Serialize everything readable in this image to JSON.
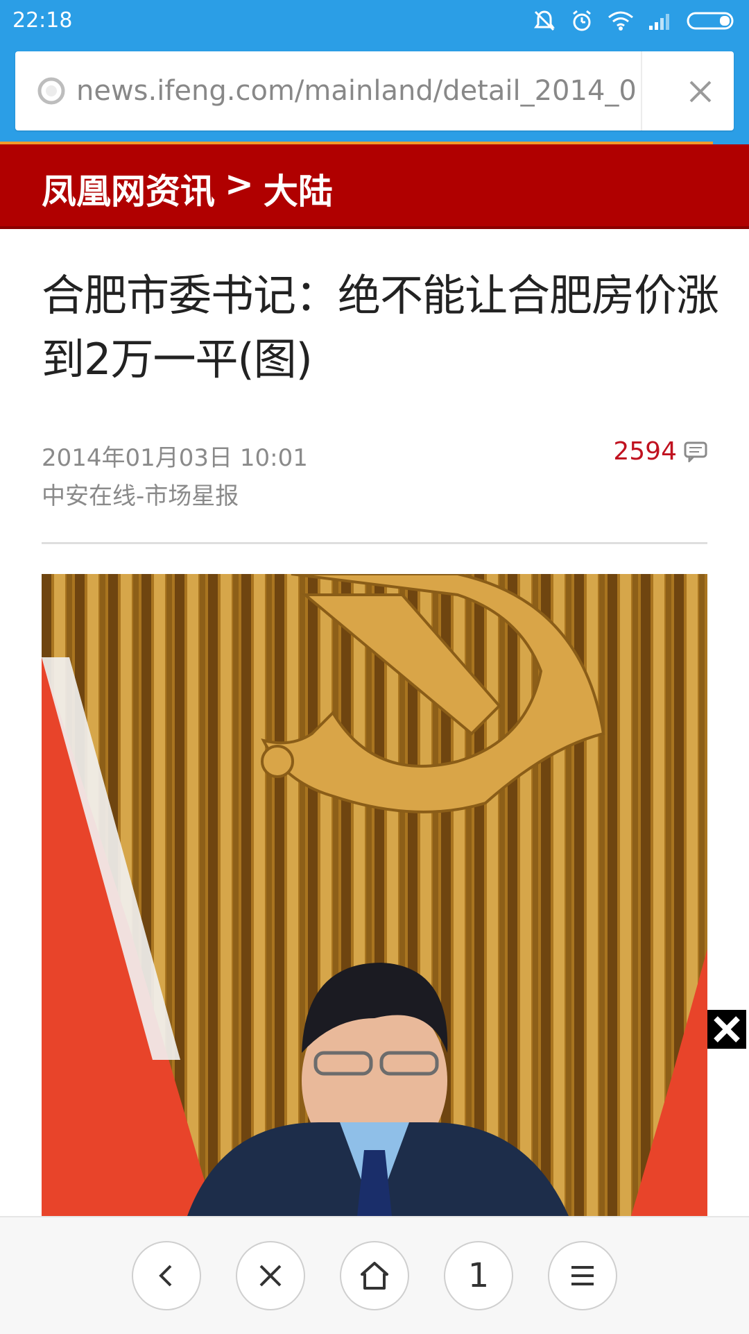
{
  "status_bar": {
    "time": "22:18",
    "icons": [
      "mute-icon",
      "alarm-icon",
      "wifi-icon",
      "signal-icon",
      "battery-icon"
    ]
  },
  "browser": {
    "url": "news.ifeng.com/mainland/detail_2014_01/0",
    "icons": [
      "site-globe-icon",
      "close-icon"
    ]
  },
  "site_header": {
    "site": "凤凰网资讯",
    "separator": ">",
    "section": "大陆",
    "color": "#b00000"
  },
  "article": {
    "title_line1": "合肥市委书记：绝不能让合肥房价涨",
    "title_line2": "到2万一平(图)",
    "date": "2014年01月03日 10:01",
    "source": "中安在线-市场星报",
    "comment_count": "2594",
    "comment_color": "#c0111f",
    "image_description_icon": "article-photo"
  },
  "bottom_toolbar": {
    "tab_count": "1",
    "icons": [
      "back-icon",
      "close-icon",
      "home-icon",
      "tabs-button",
      "menu-icon"
    ]
  },
  "colors": {
    "chrome_blue": "#2b9ee6",
    "progress": "#f39a2a"
  }
}
